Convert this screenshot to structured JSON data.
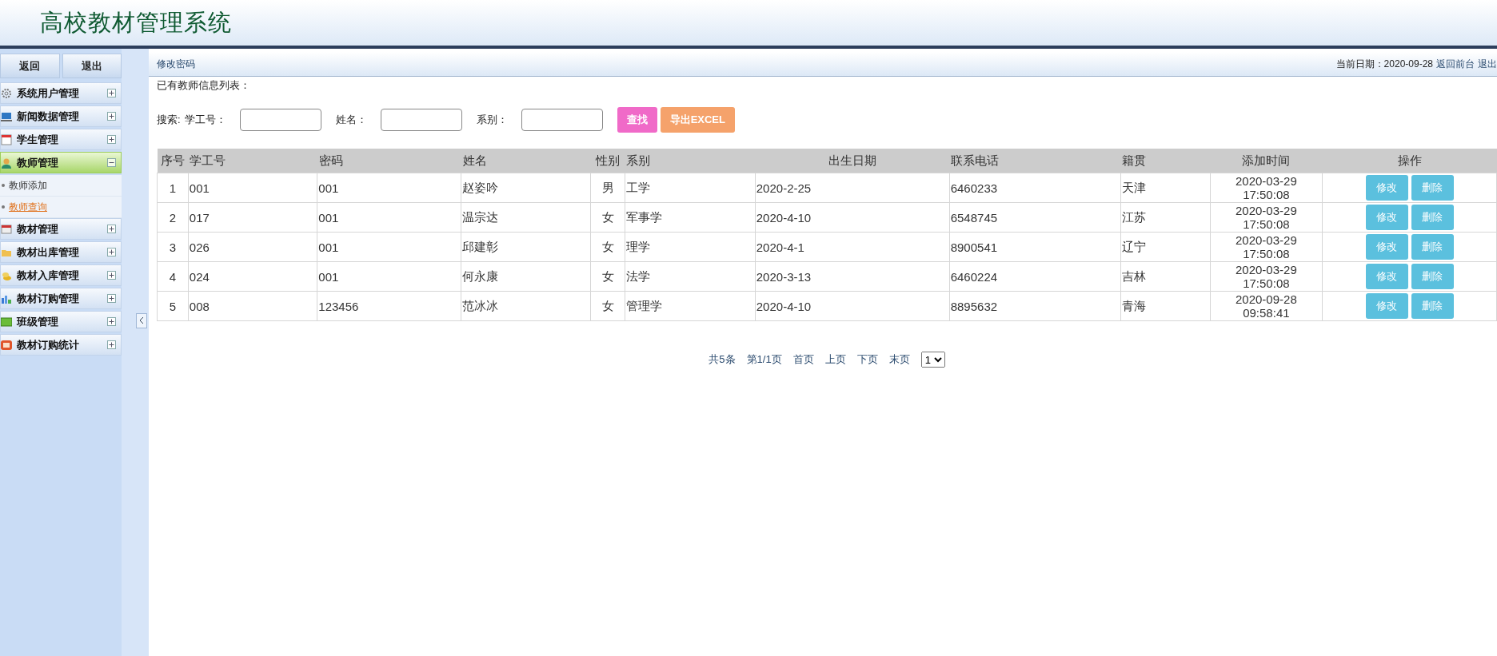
{
  "header": {
    "title": "高校教材管理系统"
  },
  "sidebar": {
    "buttons": [
      "返回",
      "退出"
    ],
    "menu": [
      {
        "label": "系统用户管理",
        "expanded": false
      },
      {
        "label": "新闻数据管理",
        "expanded": false
      },
      {
        "label": "学生管理",
        "expanded": false
      },
      {
        "label": "教师管理",
        "expanded": true,
        "children": [
          {
            "label": "教师添加",
            "selected": false
          },
          {
            "label": "教师查询",
            "selected": true
          }
        ]
      },
      {
        "label": "教材管理",
        "expanded": false
      },
      {
        "label": "教材出库管理",
        "expanded": false
      },
      {
        "label": "教材入库管理",
        "expanded": false
      },
      {
        "label": "教材订购管理",
        "expanded": false
      },
      {
        "label": "班级管理",
        "expanded": false
      },
      {
        "label": "教材订购统计",
        "expanded": false
      }
    ]
  },
  "topbar": {
    "link": "修改密码",
    "date_label": "当前日期：2020-09-28",
    "links": [
      "返回前台",
      "退出"
    ]
  },
  "list_title": "已有教师信息列表：",
  "search": {
    "label": "搜索:",
    "fields": [
      {
        "label": "学工号："
      },
      {
        "label": "姓名："
      },
      {
        "label": "系别："
      }
    ],
    "buttons": [
      {
        "label": "查找",
        "kind": "search"
      },
      {
        "label": "导出EXCEL",
        "kind": "export"
      }
    ]
  },
  "table": {
    "columns": [
      "序号",
      "学工号",
      "密码",
      "姓名",
      "性别",
      "系别",
      "出生日期",
      "联系电话",
      "籍贯",
      "添加时间",
      "操作"
    ],
    "rows": [
      {
        "cells": [
          "1",
          "001",
          "001",
          "赵姿吟",
          "男",
          "工学",
          "2020-2-25",
          "6460233",
          "天津",
          "2020-03-29 17:50:08"
        ],
        "actions": [
          "修改",
          "删除"
        ]
      },
      {
        "cells": [
          "2",
          "017",
          "001",
          "温宗达",
          "女",
          "军事学",
          "2020-4-10",
          "6548745",
          "江苏",
          "2020-03-29 17:50:08"
        ],
        "actions": [
          "修改",
          "删除"
        ]
      },
      {
        "cells": [
          "3",
          "026",
          "001",
          "邱建彰",
          "女",
          "理学",
          "2020-4-1",
          "8900541",
          "辽宁",
          "2020-03-29 17:50:08"
        ],
        "actions": [
          "修改",
          "删除"
        ]
      },
      {
        "cells": [
          "4",
          "024",
          "001",
          "何永康",
          "女",
          "法学",
          "2020-3-13",
          "6460224",
          "吉林",
          "2020-03-29 17:50:08"
        ],
        "actions": [
          "修改",
          "删除"
        ]
      },
      {
        "cells": [
          "5",
          "008",
          "123456",
          "范冰冰",
          "女",
          "管理学",
          "2020-4-10",
          "8895632",
          "青海",
          "2020-09-28 09:58:41"
        ],
        "actions": [
          "修改",
          "删除"
        ]
      }
    ]
  },
  "pagination": {
    "items": [
      "共5条",
      "第1/1页",
      "首页",
      "上页",
      "下页",
      "末页"
    ],
    "page_select": "1"
  }
}
